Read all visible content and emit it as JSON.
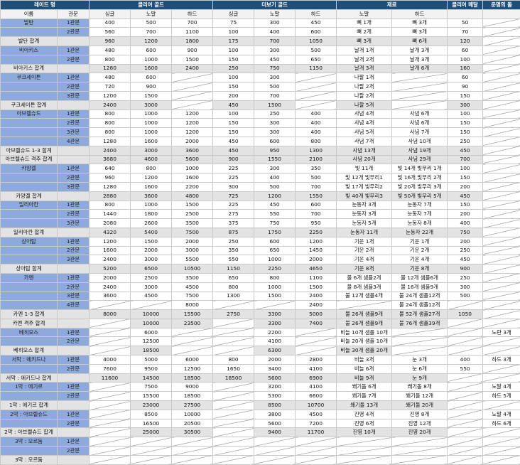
{
  "headers": {
    "row1": [
      "레이드 명",
      "클리어 골드",
      "더보기 골드",
      "재료",
      "클리어 메달",
      "운명의 돌"
    ],
    "row2": [
      "이름",
      "관문",
      "싱글",
      "노말",
      "하드",
      "싱글",
      "노말",
      "하드",
      "노말",
      "하드",
      "",
      ""
    ]
  },
  "rows": [
    [
      "발탄",
      "1관문",
      "400",
      "500",
      "700",
      "75",
      "300",
      "450",
      "뼈 1개",
      "뼈 3개",
      "50",
      ""
    ],
    [
      "",
      "2관문",
      "560",
      "700",
      "1100",
      "100",
      "400",
      "600",
      "뼈 2개",
      "뼈 3개",
      "70",
      ""
    ],
    [
      "발탄 합계",
      "",
      "960",
      "1200",
      "1800",
      "175",
      "700",
      "1050",
      "뼈 3개",
      "뼈 6개",
      "120",
      ""
    ],
    [
      "비아키스",
      "1관문",
      "480",
      "600",
      "900",
      "100",
      "300",
      "500",
      "날개 1개",
      "날개 3개",
      "60",
      ""
    ],
    [
      "",
      "2관문",
      "800",
      "1000",
      "1500",
      "150",
      "450",
      "650",
      "날개 2개",
      "날개 3개",
      "100",
      ""
    ],
    [
      "비아키스 합계",
      "",
      "1280",
      "1600",
      "2400",
      "250",
      "750",
      "1150",
      "날개 3개",
      "날개 6개",
      "160",
      ""
    ],
    [
      "쿠크세이튼",
      "1관문",
      "480",
      "600",
      "",
      "100",
      "300",
      "",
      "나팔 1개",
      "",
      "60",
      ""
    ],
    [
      "",
      "2관문",
      "720",
      "900",
      "",
      "150",
      "500",
      "",
      "나팔 2개",
      "",
      "90",
      ""
    ],
    [
      "",
      "3관문",
      "1200",
      "1500",
      "",
      "200",
      "700",
      "",
      "나팔 2개",
      "",
      "150",
      ""
    ],
    [
      "쿠크세이튼 합계",
      "",
      "2400",
      "3000",
      "",
      "450",
      "1500",
      "",
      "나팔 5개",
      "",
      "300",
      ""
    ],
    [
      "아브렐슈드",
      "1관문",
      "800",
      "1000",
      "1200",
      "100",
      "250",
      "400",
      "사념 4개",
      "사념 6개",
      "100",
      ""
    ],
    [
      "",
      "2관문",
      "800",
      "1000",
      "1200",
      "150",
      "300",
      "400",
      "사념 4개",
      "사념 6개",
      "150",
      ""
    ],
    [
      "",
      "3관문",
      "800",
      "1000",
      "1200",
      "150",
      "300",
      "400",
      "사념 5개",
      "사념 7개",
      "150",
      ""
    ],
    [
      "",
      "4관문",
      "1280",
      "1600",
      "2000",
      "450",
      "600",
      "800",
      "사념 7개",
      "사념 10개",
      "250",
      ""
    ],
    [
      "아브렐슈드 1-3 합계",
      "",
      "2400",
      "3000",
      "3600",
      "450",
      "950",
      "1300",
      "사념 13개",
      "사념 19개",
      "450",
      ""
    ],
    [
      "아브렐슈드 격주 합계",
      "",
      "3680",
      "4600",
      "5600",
      "900",
      "1550",
      "2100",
      "사념 20개",
      "사념 29개",
      "700",
      ""
    ],
    [
      "카양겔",
      "1관문",
      "640",
      "800",
      "1000",
      "225",
      "300",
      "350",
      "빛 11개",
      "빛 14개 빛무리 1개",
      "100",
      ""
    ],
    [
      "",
      "2관문",
      "960",
      "1200",
      "1600",
      "225",
      "400",
      "500",
      "빛 12개 빛무리1",
      "빛 16개 빛무리 2개",
      "150",
      ""
    ],
    [
      "",
      "3관문",
      "1280",
      "1600",
      "2200",
      "300",
      "500",
      "700",
      "빛 17개 빛무리2",
      "빛 20개 빛무리 3개",
      "200",
      ""
    ],
    [
      "카양겔 합계",
      "",
      "2880",
      "3600",
      "4800",
      "725",
      "1200",
      "1550",
      "빛 40개 빛무리3",
      "빛 50개 빛무리 5개",
      "450",
      ""
    ],
    [
      "일리아칸",
      "1관문",
      "800",
      "1000",
      "1500",
      "225",
      "450",
      "600",
      "눈동자 3개",
      "눈동자 7개",
      "150",
      ""
    ],
    [
      "",
      "2관문",
      "1440",
      "1800",
      "2500",
      "275",
      "550",
      "700",
      "눈동자 3개",
      "눈동자 7개",
      "200",
      ""
    ],
    [
      "",
      "3관문",
      "2080",
      "2600",
      "3500",
      "375",
      "750",
      "950",
      "눈동자 5개",
      "눈동자 8개",
      "400",
      ""
    ],
    [
      "일리아칸 합계",
      "",
      "4320",
      "5400",
      "7500",
      "875",
      "1750",
      "2250",
      "눈동자 11개",
      "눈동자 22개",
      "750",
      ""
    ],
    [
      "상아탑",
      "1관문",
      "1200",
      "1500",
      "2000",
      "250",
      "600",
      "1200",
      "기운 1개",
      "기운 1개",
      "200",
      ""
    ],
    [
      "",
      "2관문",
      "1600",
      "2000",
      "3000",
      "350",
      "650",
      "1450",
      "기운 2개",
      "기운 2개",
      "250",
      ""
    ],
    [
      "",
      "3관문",
      "2400",
      "3000",
      "5500",
      "550",
      "1000",
      "2000",
      "기운 4개",
      "기운 4개",
      "450",
      ""
    ],
    [
      "상아탑 합계",
      "",
      "5200",
      "6500",
      "10500",
      "1150",
      "2250",
      "4650",
      "기운 8개",
      "기운 8개",
      "900",
      ""
    ],
    [
      "카멘",
      "1관문",
      "2000",
      "2500",
      "3500",
      "650",
      "800",
      "1100",
      "불 6개 샘플2개",
      "불 12개 샘플6개",
      "250",
      ""
    ],
    [
      "",
      "2관문",
      "2400",
      "3000",
      "4500",
      "800",
      "1000",
      "1500",
      "불 8개 샘플3개",
      "불 16개 샘플9개",
      "300",
      ""
    ],
    [
      "",
      "3관문",
      "3600",
      "4500",
      "7500",
      "1300",
      "1500",
      "2400",
      "불 12개 샘플4개",
      "불 24개 샘플12개",
      "500",
      ""
    ],
    [
      "",
      "4관문",
      "",
      "",
      "8000",
      "",
      "",
      "2400",
      "",
      "불 24개 샘플12개",
      "",
      ""
    ],
    [
      "카멘 1-3 합계",
      "",
      "8000",
      "10000",
      "15500",
      "2750",
      "3300",
      "5000",
      "불 26개 샘플9개",
      "불 52개 샘플27개",
      "1050",
      ""
    ],
    [
      "카멘 격주 합계",
      "",
      "",
      "10000",
      "23500",
      "",
      "3300",
      "7400",
      "불 26개 샘플9개",
      "불 76개 샘플39개",
      "",
      ""
    ],
    [
      "베히모스",
      "1관문",
      "",
      "6000",
      "",
      "",
      "2200",
      "",
      "비늘 10개 샘플 10개",
      "",
      "",
      "노란 3개"
    ],
    [
      "",
      "2관문",
      "",
      "12500",
      "",
      "",
      "4100",
      "",
      "비늘 20개 샘플 10개",
      "",
      "",
      ""
    ],
    [
      "베히모스 합계",
      "",
      "",
      "18500",
      "",
      "",
      "6300",
      "",
      "비늘 30개 샘플 20개",
      "",
      "",
      ""
    ],
    [
      "서막 : 에키드나",
      "1관문",
      "4000",
      "5000",
      "6000",
      "800",
      "2000",
      "2800",
      "비늘 3개",
      "눈 3개",
      "400",
      "하드 3개"
    ],
    [
      "",
      "2관문",
      "7600",
      "9500",
      "12500",
      "1650",
      "3400",
      "4100",
      "비늘 6개",
      "눈 6개",
      "550",
      ""
    ],
    [
      "서막 : 에키드나 합계",
      "",
      "11600",
      "14500",
      "18500",
      "18500",
      "5600",
      "6900",
      "비늘 9개",
      "눈 9개",
      "",
      ""
    ],
    [
      "1막 : 에기르",
      "1관문",
      "",
      "7500",
      "9000",
      "",
      "3200",
      "4100",
      "쐐기돌 6개",
      "쐐기돌 8개",
      "",
      "노말 4개"
    ],
    [
      "",
      "2관문",
      "",
      "15500",
      "18500",
      "",
      "5300",
      "6600",
      "쐐기돌 7개",
      "쐐기돌 12개",
      "",
      "하드 5개"
    ],
    [
      "1막 : 에기르 합계",
      "",
      "",
      "23000",
      "27500",
      "",
      "8500",
      "10700",
      "쐐기돌 13개",
      "쐐기돌 20개",
      "",
      ""
    ],
    [
      "2막 : 아브렐슈드",
      "1관문",
      "",
      "8500",
      "10000",
      "",
      "3800",
      "4500",
      "진영 4개",
      "진영 8개",
      "",
      "노말 4개"
    ],
    [
      "",
      "2관문",
      "",
      "16500",
      "20500",
      "",
      "5600",
      "7200",
      "진영 6개",
      "진영 12개",
      "",
      "하드 6개"
    ],
    [
      "2막 : 아브렐슈드 합계",
      "",
      "",
      "25000",
      "30500",
      "",
      "9400",
      "11700",
      "진영 10개",
      "진영 20개",
      "",
      ""
    ],
    [
      "3막 : 모르둠",
      "1관문",
      "",
      "",
      "",
      "",
      "",
      "",
      "",
      "",
      "",
      ""
    ],
    [
      "",
      "2관문",
      "",
      "",
      "",
      "",
      "",
      "",
      "",
      "",
      "",
      ""
    ],
    [
      "3막 : 모르둠",
      "",
      "",
      "",
      "",
      "",
      "",
      "",
      "",
      "",
      "",
      ""
    ]
  ]
}
